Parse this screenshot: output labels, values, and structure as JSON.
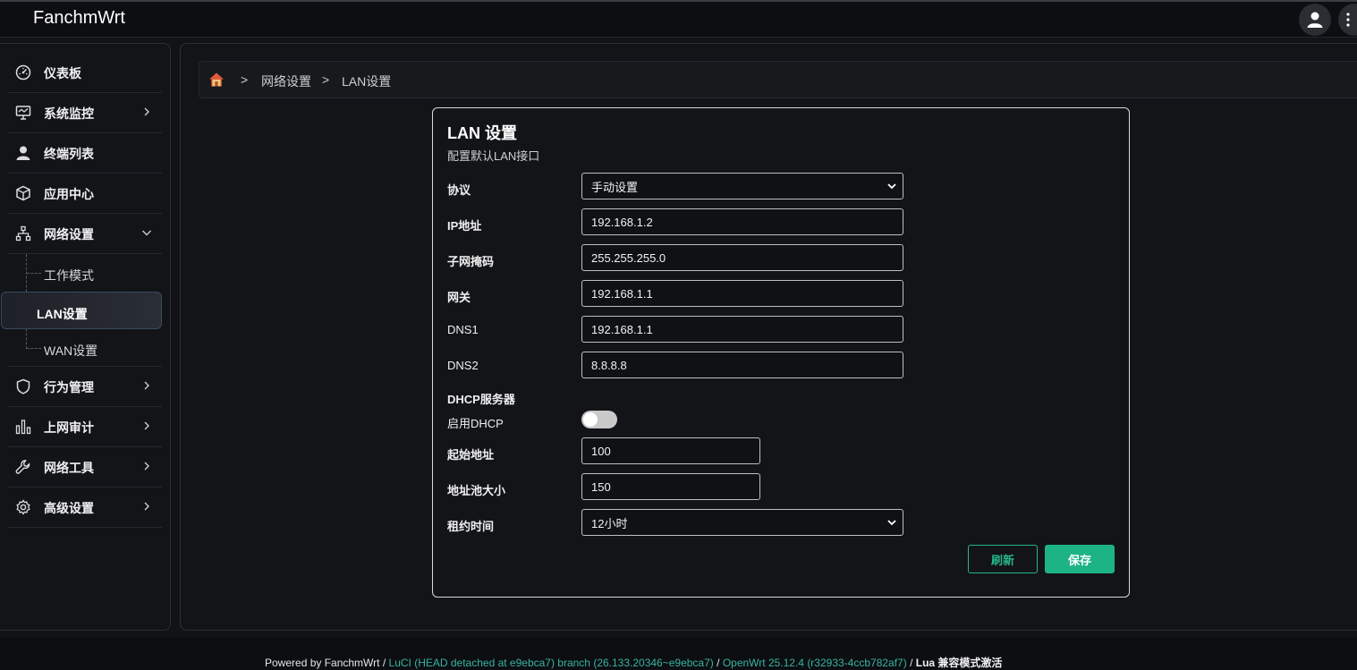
{
  "header": {
    "brand": "FanchmWrt"
  },
  "sidebar": {
    "items": [
      {
        "label": "仪表板",
        "icon": "dashboard-icon"
      },
      {
        "label": "系统监控",
        "icon": "monitor-icon",
        "has_arrow": true
      },
      {
        "label": "终端列表",
        "icon": "user-icon"
      },
      {
        "label": "应用中心",
        "icon": "cube-icon"
      },
      {
        "label": "网络设置",
        "icon": "network-icon",
        "expanded": true
      },
      {
        "label": "行为管理",
        "icon": "shield-icon",
        "has_arrow": true
      },
      {
        "label": "上网审计",
        "icon": "bar-chart-icon",
        "has_arrow": true
      },
      {
        "label": "网络工具",
        "icon": "wrench-icon",
        "has_arrow": true
      },
      {
        "label": "高级设置",
        "icon": "gear-icon",
        "has_arrow": true
      }
    ],
    "network_sub": [
      {
        "label": "工作模式"
      },
      {
        "label": "LAN设置",
        "active": true
      },
      {
        "label": "WAN设置"
      }
    ]
  },
  "breadcrumb": {
    "sep": ">",
    "level1": "网络设置",
    "level2": "LAN设置"
  },
  "card": {
    "title": "LAN 设置",
    "description": "配置默认LAN接口",
    "fields": {
      "protocol": {
        "label": "协议",
        "value": "手动设置"
      },
      "ip": {
        "label": "IP地址",
        "value": "192.168.1.2"
      },
      "netmask": {
        "label": "子网掩码",
        "value": "255.255.255.0"
      },
      "gateway": {
        "label": "网关",
        "value": "192.168.1.1"
      },
      "dns1": {
        "label": "DNS1",
        "value": "192.168.1.1"
      },
      "dns2": {
        "label": "DNS2",
        "value": "8.8.8.8"
      }
    },
    "dhcp": {
      "section": "DHCP服务器",
      "enable_label": "启用DHCP",
      "enabled": false,
      "start": {
        "label": "起始地址",
        "value": "100"
      },
      "pool": {
        "label": "地址池大小",
        "value": "150"
      },
      "lease": {
        "label": "租约时间",
        "value": "12小时"
      }
    },
    "buttons": {
      "refresh": "刷新",
      "save": "保存"
    }
  },
  "footer": {
    "powered": "Powered by FanchmWrt /",
    "luci": "LuCI (HEAD detached at e9ebca7) branch (26.133.20346~e9ebca7)",
    "sep1": "/",
    "openwrt": "OpenWrt 25.12.4 (r32933-4ccb782af7)",
    "sep2": "/",
    "lua": "Lua 兼容模式激活"
  },
  "colors": {
    "accent": "#1db384",
    "link": "#39b3a3"
  }
}
